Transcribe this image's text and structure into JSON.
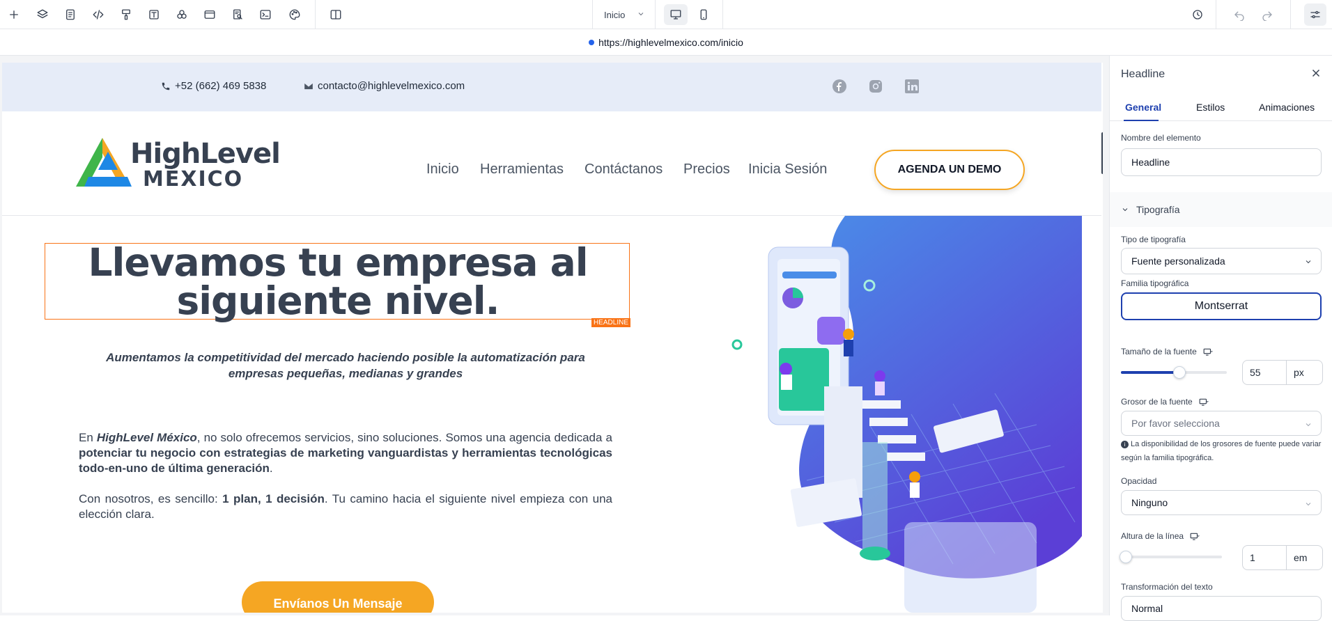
{
  "toolbar": {
    "icons": [
      "plus-icon",
      "layers-icon",
      "pages-icon",
      "code-icon",
      "paint-icon",
      "text-icon",
      "components-icon",
      "browser-icon",
      "search-page-icon",
      "terminal-icon",
      "palette-icon",
      "layout-columns-icon"
    ],
    "page_select": "Inicio",
    "right_icons": [
      "history-icon",
      "undo-icon",
      "redo-icon",
      "settings-sliders-icon"
    ]
  },
  "url": "https://highlevelmexico.com/inicio",
  "site": {
    "phone": "+52 (662) 469 5838",
    "email": "contacto@highlevelmexico.com",
    "social": [
      "facebook-icon",
      "instagram-icon",
      "linkedin-icon"
    ],
    "logo_line1": "HighLevel",
    "logo_line2": "MÉXICO",
    "nav": [
      "Inicio",
      "Herramientas",
      "Contáctanos",
      "Precios",
      "Inicia Sesión"
    ],
    "cta": "AGENDA UN DEMO",
    "headline_line1": "Llevamos tu empresa al",
    "headline_line2": "siguiente nivel.",
    "headline_tag": "HEADLINE",
    "subtitle": "Aumentamos la competitividad del mercado haciendo posible la automatización para empresas pequeñas, medianas y grandes",
    "para1_a": "En ",
    "para1_b": "HighLevel México",
    "para1_c": ", no solo ofrecemos servicios, sino soluciones. Somos una agencia dedicada a ",
    "para1_d": "potenciar tu negocio con estrategias de marketing vanguardistas y herramientas tecnológicas todo-en-uno de última generación",
    "para1_e": ".",
    "para2_a": "Con nosotros, es sencillo: ",
    "para2_b": "1 plan, 1 decisión",
    "para2_c": ". Tu camino hacia el siguiente nivel empieza con una elección clara.",
    "send_button": "Envíanos Un Mensaje"
  },
  "panel": {
    "title": "Headline",
    "tabs": [
      "General",
      "Estilos",
      "Animaciones"
    ],
    "element_name_label": "Nombre del elemento",
    "element_name_value": "Headline",
    "section": "Tipografía",
    "font_type_label": "Tipo de tipografía",
    "font_type_value": "Fuente personalizada",
    "font_family_label": "Familia tipográfica",
    "font_family_value": "Montserrat",
    "font_size_label": "Tamaño de la fuente",
    "font_size_value": "55",
    "font_size_unit": "px",
    "font_size_slider": 0.55,
    "font_weight_label": "Grosor de la fuente",
    "font_weight_placeholder": "Por favor selecciona",
    "font_weight_note": "La disponibilidad de los grosores de fuente puede variar según la familia tipográfica.",
    "opacity_label": "Opacidad",
    "opacity_value": "Ninguno",
    "line_height_label": "Altura de la línea",
    "line_height_value": "1",
    "line_height_unit": "em",
    "line_height_slider": 0.0,
    "text_transform_label": "Transformación del texto",
    "text_transform_value": "Normal"
  },
  "colors": {
    "accent": "#1e40af",
    "cta_orange": "#f5a623",
    "selection": "#f97316",
    "topbar_bg": "#e6ecf8"
  }
}
